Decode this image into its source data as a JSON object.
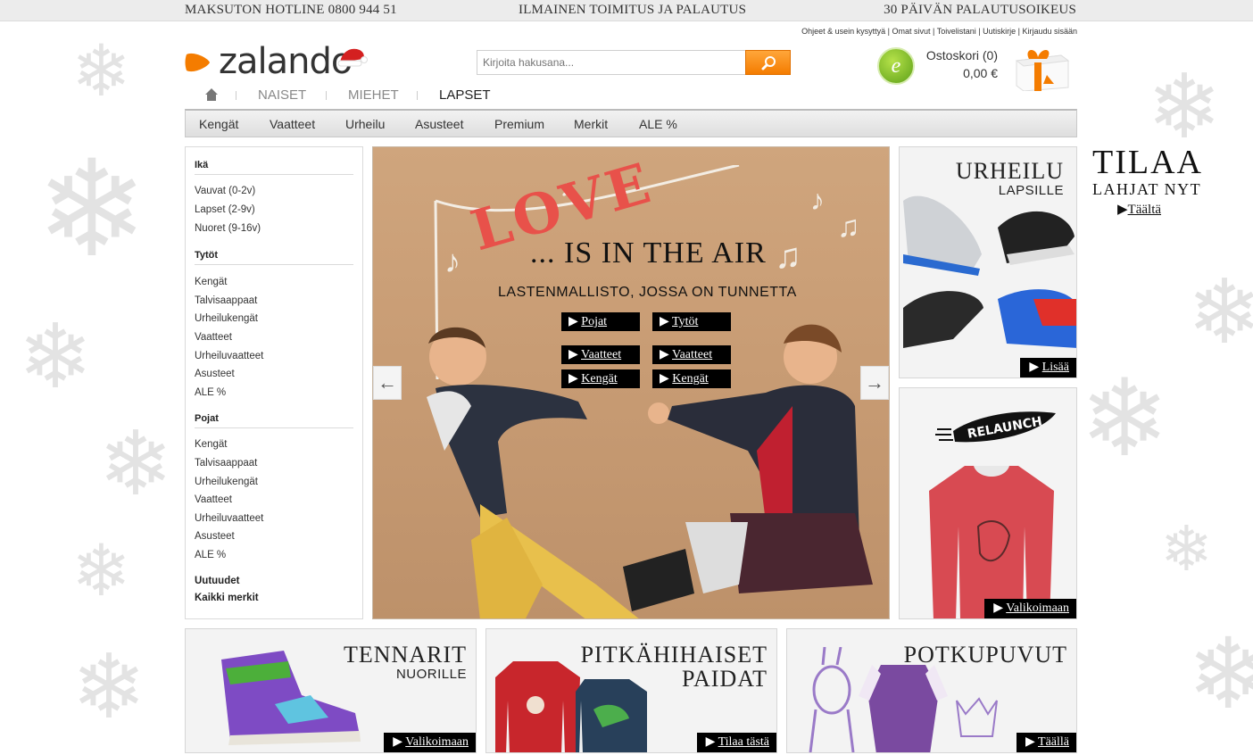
{
  "topbar": {
    "hotline": "MAKSUTON HOTLINE 0800 944 51",
    "shipping": "ILMAINEN TOIMITUS JA PALAUTUS",
    "returns": "30 PÄIVÄN PALAUTUSOIKEUS"
  },
  "utility_links": [
    "Ohjeet & usein kysyttyä",
    "Omat sivut",
    "Toivelistani",
    "Uutiskirje",
    "Kirjaudu sisään"
  ],
  "logo": {
    "text": "zalando"
  },
  "search": {
    "placeholder": "Kirjoita hakusana..."
  },
  "cart": {
    "label": "Ostoskori (0)",
    "total": "0,00 €"
  },
  "ebadge": "e",
  "main_tabs": [
    "NAISET",
    "MIEHET",
    "LAPSET"
  ],
  "active_tab": "LAPSET",
  "subnav": [
    "Kengät",
    "Vaatteet",
    "Urheilu",
    "Asusteet",
    "Premium",
    "Merkit",
    "ALE %"
  ],
  "sidebar": {
    "age_heading": "Ikä",
    "age_items": [
      "Vauvat (0-2v)",
      "Lapset (2-9v)",
      "Nuoret (9-16v)"
    ],
    "girls_heading": "Tytöt",
    "girls_items": [
      "Kengät",
      "Talvisaappaat",
      "Urheilukengät",
      "Vaatteet",
      "Urheiluvaatteet",
      "Asusteet",
      "ALE %"
    ],
    "boys_heading": "Pojat",
    "boys_items": [
      "Kengät",
      "Talvisaappaat",
      "Urheilukengät",
      "Vaatteet",
      "Urheiluvaatteet",
      "Asusteet",
      "ALE %"
    ],
    "new": "Uutuudet",
    "all_brands": "Kaikki merkit"
  },
  "hero": {
    "love": "LOVE",
    "headline": "... IS IN THE AIR",
    "subline": "LASTENMALLISTO, JOSSA ON TUNNETTA",
    "boys": "Pojat",
    "girls": "Tytöt",
    "boys_clothes": "Vaatteet",
    "girls_clothes": "Vaatteet",
    "boys_shoes": "Kengät",
    "girls_shoes": "Kengät",
    "prev": "←",
    "next": "→"
  },
  "promo_sport": {
    "title": "URHEILU",
    "subtitle": "LAPSILLE",
    "cta": "Lisää"
  },
  "promo_relaunch": {
    "brand": "RELAUNCH",
    "cta": "Valikoimaan"
  },
  "promo_sneakers": {
    "title": "TENNARIT",
    "subtitle": "NUORILLE",
    "cta": "Valikoimaan"
  },
  "promo_longsleeve": {
    "title1": "PITKÄHIHAISET",
    "title2": "PAIDAT",
    "cta": "Tilaa tästä"
  },
  "promo_rompers": {
    "title": "POTKUPUVUT",
    "cta": "Täällä"
  },
  "gift": {
    "big": "TILAA",
    "mid": "LAHJAT NYT",
    "link": "Täältä"
  },
  "colors": {
    "orange": "#f47c00",
    "love_red": "#e8514a",
    "green": "#5da018"
  }
}
